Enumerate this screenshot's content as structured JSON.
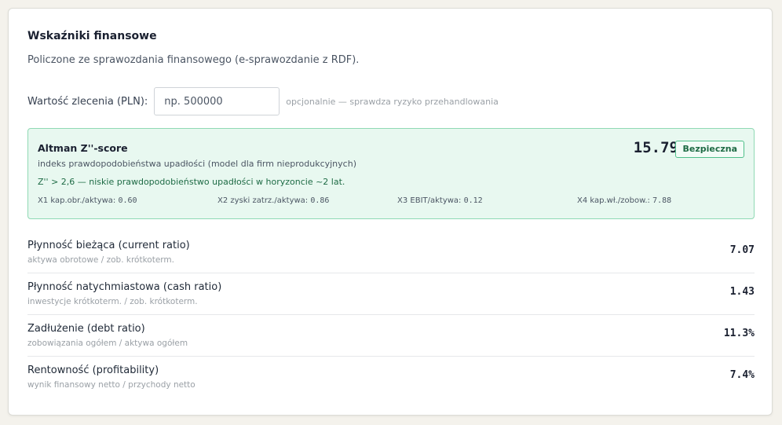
{
  "card": {
    "title": "Wskaźniki finansowe",
    "subtitle": "Policzone ze sprawozdania finansowego (e-sprawozdanie z RDF)."
  },
  "order": {
    "label": "Wartość zlecenia (PLN):",
    "value": "",
    "placeholder": "np. 500000",
    "hint": "opcjonalnie — sprawdza ryzyko przehandlowania"
  },
  "altman": {
    "title": "Altman Z''-score",
    "description": "indeks prawdopodobieństwa upadłości (model dla firm nieprodukcyjnych)",
    "interpretation": "Z'' > 2,6 — niskie prawdopodobieństwo upadłości w horyzoncie ~2 lat.",
    "score": "15.79",
    "badge": "Bezpieczna",
    "factors": [
      {
        "label": "X1 kap.obr./aktywa:",
        "value": "0.60"
      },
      {
        "label": "X2 zyski zatrz./aktywa:",
        "value": "0.86"
      },
      {
        "label": "X3 EBIT/aktywa:",
        "value": "0.12"
      },
      {
        "label": "X4 kap.wł./zobow.:",
        "value": "7.88"
      }
    ]
  },
  "metrics": [
    {
      "name": "Płynność bieżąca (current ratio)",
      "desc": "aktywa obrotowe / zob. krótkoterm.",
      "value": "7.07"
    },
    {
      "name": "Płynność natychmiastowa (cash ratio)",
      "desc": "inwestycje krótkoterm. / zob. krótkoterm.",
      "value": "1.43"
    },
    {
      "name": "Zadłużenie (debt ratio)",
      "desc": "zobowiązania ogółem / aktywa ogółem",
      "value": "11.3%"
    },
    {
      "name": "Rentowność (profitability)",
      "desc": "wynik finansowy netto / przychody netto",
      "value": "7.4%"
    }
  ],
  "colors": {
    "accent_green": "#1e6b45",
    "altman_bg": "#e8f8f0",
    "altman_border": "#8fd9b4"
  }
}
